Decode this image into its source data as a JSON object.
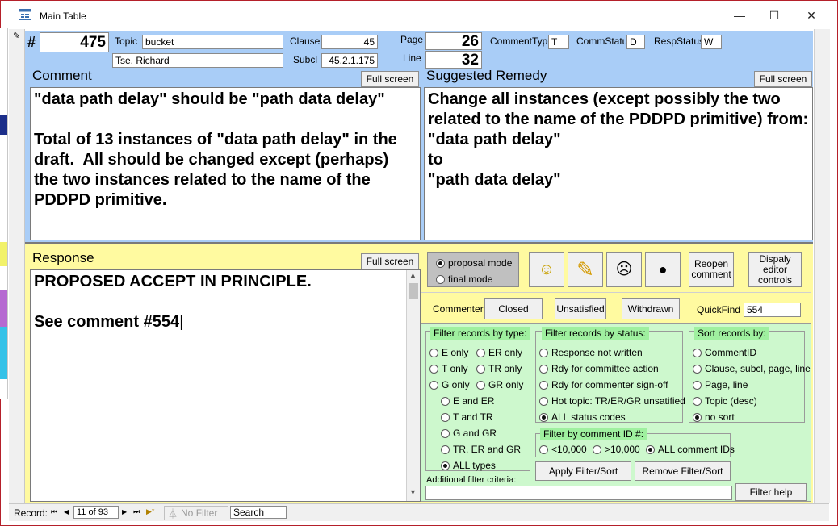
{
  "window": {
    "title": "Main Table"
  },
  "header": {
    "hash": "#",
    "record_id": "475",
    "topic_label": "Topic",
    "topic_value": "bucket",
    "commenter_name": "Tse, Richard",
    "clause_label": "Clause",
    "clause_value": "45",
    "subcl_label": "Subcl",
    "subcl_value": "45.2.1.175",
    "page_label": "Page",
    "page_value": "26",
    "line_label": "Line",
    "line_value": "32",
    "comment_type_label": "CommentType",
    "comment_type_value": "T",
    "comm_status_label": "CommStatus",
    "comm_status_value": "D",
    "resp_status_label": "RespStatus",
    "resp_status_value": "W"
  },
  "comment": {
    "label": "Comment",
    "full_screen": "Full screen",
    "text": "\"data path delay\" should be \"path data delay\"\n\nTotal of 13 instances of \"data path delay\" in the draft.  All should be changed except (perhaps) the two instances related to the name of the PDDPD primitive."
  },
  "remedy": {
    "label": "Suggested Remedy",
    "full_screen": "Full screen",
    "text": "Change all instances (except possibly the two related to the name of the PDDPD primitive) from:\n\"data path delay\"\nto\n\"path data delay\""
  },
  "response": {
    "label": "Response",
    "full_screen": "Full screen",
    "text": "PROPOSED ACCEPT IN PRINCIPLE.\n\nSee comment #554"
  },
  "mode": {
    "proposal": "proposal mode",
    "final": "final mode"
  },
  "tools": {
    "reopen": "Reopen comment",
    "display_editor": "Dispaly editor controls"
  },
  "commenter_bar": {
    "commenter_label": "Commenter",
    "closed": "Closed",
    "unsatisfied": "Unsatisfied",
    "withdrawn": "Withdrawn",
    "quickfind_label": "QuickFind",
    "quickfind_value": "554"
  },
  "filter_type": {
    "title": "Filter records by type:",
    "e_only": "E only",
    "er_only": "ER only",
    "t_only": "T only",
    "tr_only": "TR only",
    "g_only": "G only",
    "gr_only": "GR only",
    "e_and_er": "E and ER",
    "t_and_tr": "T and TR",
    "g_and_gr": "G and GR",
    "tr_er_gr": "TR, ER and GR",
    "all_types": "ALL types"
  },
  "filter_status": {
    "title": "Filter records by status:",
    "not_written": "Response not written",
    "rdy_committee": "Rdy for committee action",
    "rdy_signoff": "Rdy for commenter sign-off",
    "hot_topic": "Hot topic: TR/ER/GR unsatified",
    "all_status": "ALL status codes"
  },
  "sort": {
    "title": "Sort records by:",
    "comment_id": "CommentID",
    "clause_subcl": "Clause, subcl, page, line",
    "page_line": "Page, line",
    "topic_desc": "Topic (desc)",
    "no_sort": "no sort"
  },
  "filter_id": {
    "title": "Filter by comment ID #:",
    "lt": "<10,000",
    "gt": ">10,000",
    "all": "ALL comment IDs"
  },
  "filter_actions": {
    "apply": "Apply Filter/Sort",
    "remove": "Remove Filter/Sort",
    "additional_label": "Additional filter criteria:",
    "help": "Filter help"
  },
  "status_bar": {
    "record_label": "Record:",
    "nav_first": "⏮",
    "nav_prev": "◀",
    "nav_next": "▶",
    "nav_last": "⏭",
    "nav_new": "▶*",
    "position": "11 of 93",
    "no_filter": "No Filter",
    "search": "Search"
  },
  "colors": {
    "blue_panel": "#a9cdf7",
    "yellow_panel": "#fffaa0",
    "green_panel": "#cdf8cd",
    "green_title": "#9ff09f"
  }
}
